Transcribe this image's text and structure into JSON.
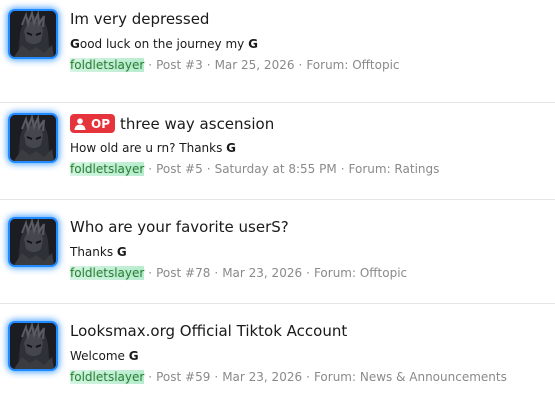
{
  "colors": {
    "avatar_glow": "#1f8bff",
    "op_badge": "#e5343b",
    "username_text": "#2e7d32",
    "meta_text": "#8a8a8a"
  },
  "results": [
    {
      "title": "Im very depressed",
      "op": false,
      "snippet": "Good luck on the journey my G",
      "username": "foldletslayer",
      "post": "Post #3",
      "date": "Mar 25, 2026",
      "forum": "Forum: Offtopic"
    },
    {
      "title": "three way ascension",
      "op": true,
      "op_label": "OP",
      "snippet": "How old are u rn? Thanks G",
      "username": "foldletslayer",
      "post": "Post #5",
      "date": "Saturday at 8:55 PM",
      "forum": "Forum: Ratings"
    },
    {
      "title": "Who are your favorite userS?",
      "op": false,
      "snippet": "Thanks G",
      "username": "foldletslayer",
      "post": "Post #78",
      "date": "Mar 23, 2026",
      "forum": "Forum: Offtopic"
    },
    {
      "title": "Looksmax.org Official Tiktok Account",
      "op": false,
      "snippet": "Welcome G",
      "username": "foldletslayer",
      "post": "Post #59",
      "date": "Mar 23, 2026",
      "forum": "Forum: News & Announcements"
    }
  ],
  "separator": "·"
}
